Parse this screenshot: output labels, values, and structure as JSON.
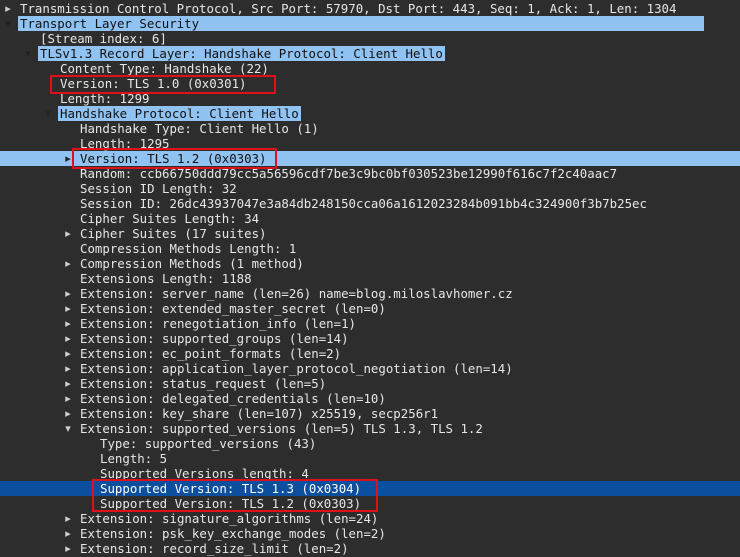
{
  "tree": {
    "rows": [
      {
        "text": "Transmission Control Protocol, Src Port: 57970, Dst Port: 443, Seq: 1, Ack: 1, Len: 1304",
        "toggle": "collapsed"
      },
      {
        "text": "Transport Layer Security",
        "toggle": "expanded"
      },
      {
        "text": "[Stream index: 6]",
        "toggle": ""
      },
      {
        "text": "TLSv1.3 Record Layer: Handshake Protocol: Client Hello",
        "toggle": "expanded"
      },
      {
        "text": "Content Type: Handshake (22)",
        "toggle": ""
      },
      {
        "text": "Version: TLS 1.0 (0x0301)",
        "toggle": ""
      },
      {
        "text": "Length: 1299",
        "toggle": ""
      },
      {
        "text": "Handshake Protocol: Client Hello",
        "toggle": "expanded"
      },
      {
        "text": "Handshake Type: Client Hello (1)",
        "toggle": ""
      },
      {
        "text": "Length: 1295",
        "toggle": ""
      },
      {
        "text": "Version: TLS 1.2 (0x0303)",
        "toggle": "collapsed"
      },
      {
        "text": "Random: ccb66750ddd79cc5a56596cdf7be3c9bc0bf030523be12990f616c7f2c40aac7",
        "toggle": ""
      },
      {
        "text": "Session ID Length: 32",
        "toggle": ""
      },
      {
        "text": "Session ID: 26dc43937047e3a84db248150cca06a1612023284b091bb4c324900f3b7b25ec",
        "toggle": ""
      },
      {
        "text": "Cipher Suites Length: 34",
        "toggle": ""
      },
      {
        "text": "Cipher Suites (17 suites)",
        "toggle": "collapsed"
      },
      {
        "text": "Compression Methods Length: 1",
        "toggle": ""
      },
      {
        "text": "Compression Methods (1 method)",
        "toggle": "collapsed"
      },
      {
        "text": "Extensions Length: 1188",
        "toggle": ""
      },
      {
        "text": "Extension: server_name (len=26) name=blog.miloslavhomer.cz",
        "toggle": "collapsed"
      },
      {
        "text": "Extension: extended_master_secret (len=0)",
        "toggle": "collapsed"
      },
      {
        "text": "Extension: renegotiation_info (len=1)",
        "toggle": "collapsed"
      },
      {
        "text": "Extension: supported_groups (len=14)",
        "toggle": "collapsed"
      },
      {
        "text": "Extension: ec_point_formats (len=2)",
        "toggle": "collapsed"
      },
      {
        "text": "Extension: application_layer_protocol_negotiation (len=14)",
        "toggle": "collapsed"
      },
      {
        "text": "Extension: status_request (len=5)",
        "toggle": "collapsed"
      },
      {
        "text": "Extension: delegated_credentials (len=10)",
        "toggle": "collapsed"
      },
      {
        "text": "Extension: key_share (len=107) x25519, secp256r1",
        "toggle": "collapsed"
      },
      {
        "text": "Extension: supported_versions (len=5) TLS 1.3, TLS 1.2",
        "toggle": "expanded"
      },
      {
        "text": "Type: supported_versions (43)",
        "toggle": ""
      },
      {
        "text": "Length: 5",
        "toggle": ""
      },
      {
        "text": "Supported Versions length: 4",
        "toggle": ""
      },
      {
        "text": "Supported Version: TLS 1.3 (0x0304)",
        "toggle": ""
      },
      {
        "text": "Supported Version: TLS 1.2 (0x0303)",
        "toggle": ""
      },
      {
        "text": "Extension: signature_algorithms (len=24)",
        "toggle": "collapsed"
      },
      {
        "text": "Extension: psk_key_exchange_modes (len=2)",
        "toggle": "collapsed"
      },
      {
        "text": "Extension: record_size_limit (len=2)",
        "toggle": "collapsed"
      }
    ]
  },
  "colors": {
    "background": "#2d2d2d",
    "text": "#e6e6e6",
    "highlight": "#90c2f2",
    "selected": "#0b4f9e",
    "annotation_box": "#e0101a"
  }
}
